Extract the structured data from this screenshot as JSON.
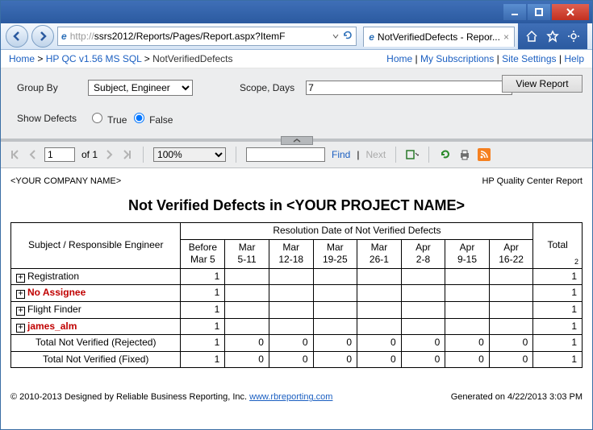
{
  "browser": {
    "url_prefix": "http://",
    "url_rest": "ssrs2012/Reports/Pages/Report.aspx?ItemF",
    "tab_title": "NotVerifiedDefects - Repor..."
  },
  "ssrs_nav": {
    "crumbs": [
      "Home",
      "HP QC v1.56 MS SQL",
      "NotVerifiedDefects"
    ],
    "right_links": [
      "Home",
      "My Subscriptions",
      "Site Settings",
      "Help"
    ]
  },
  "params": {
    "group_by_label": "Group By",
    "group_by_value": "Subject, Engineer",
    "scope_label": "Scope, Days",
    "scope_value": "7",
    "show_defects_label": "Show Defects",
    "true_label": "True",
    "false_label": "False",
    "view_button": "View Report"
  },
  "toolbar": {
    "page_current": "1",
    "page_of": "of 1",
    "zoom": "100%",
    "search_value": "",
    "find": "Find",
    "next": "Next"
  },
  "report": {
    "company": "<YOUR COMPANY NAME>",
    "heading_right": "HP Quality Center Report",
    "title": "Not Verified Defects in <YOUR PROJECT NAME>",
    "subject_header": "Subject / Responsible Engineer",
    "group_header": "Resolution Date of Not Verified Defects",
    "total_header": "Total",
    "total_sub": "2",
    "columns": [
      {
        "l1": "Before",
        "l2": "Mar 5"
      },
      {
        "l1": "Mar",
        "l2": "5-11"
      },
      {
        "l1": "Mar",
        "l2": "12-18"
      },
      {
        "l1": "Mar",
        "l2": "19-25"
      },
      {
        "l1": "Mar",
        "l2": "26-1"
      },
      {
        "l1": "Apr",
        "l2": "2-8"
      },
      {
        "l1": "Apr",
        "l2": "9-15"
      },
      {
        "l1": "Apr",
        "l2": "16-22"
      }
    ],
    "rows": [
      {
        "type": "subject",
        "label": "Registration",
        "vals": [
          "1",
          "",
          "",
          "",
          "",
          "",
          "",
          ""
        ],
        "total": "1"
      },
      {
        "type": "assignee",
        "label": "No Assignee",
        "vals": [
          "1",
          "",
          "",
          "",
          "",
          "",
          "",
          ""
        ],
        "total": "1"
      },
      {
        "type": "subject",
        "label": "Flight Finder",
        "vals": [
          "1",
          "",
          "",
          "",
          "",
          "",
          "",
          ""
        ],
        "total": "1"
      },
      {
        "type": "assignee",
        "label": "james_alm",
        "vals": [
          "1",
          "",
          "",
          "",
          "",
          "",
          "",
          ""
        ],
        "total": "1"
      },
      {
        "type": "total",
        "label": "Total Not Verified (Rejected)",
        "vals": [
          "1",
          "0",
          "0",
          "0",
          "0",
          "0",
          "0",
          "0"
        ],
        "total": "1"
      },
      {
        "type": "total",
        "label": "Total Not Verified (Fixed)",
        "vals": [
          "1",
          "0",
          "0",
          "0",
          "0",
          "0",
          "0",
          "0"
        ],
        "total": "1"
      }
    ],
    "footer_left": "© 2010-2013 Designed by Reliable Business Reporting, Inc. ",
    "footer_link": "www.rbreporting.com",
    "footer_right": "Generated on 4/22/2013 3:03 PM"
  }
}
